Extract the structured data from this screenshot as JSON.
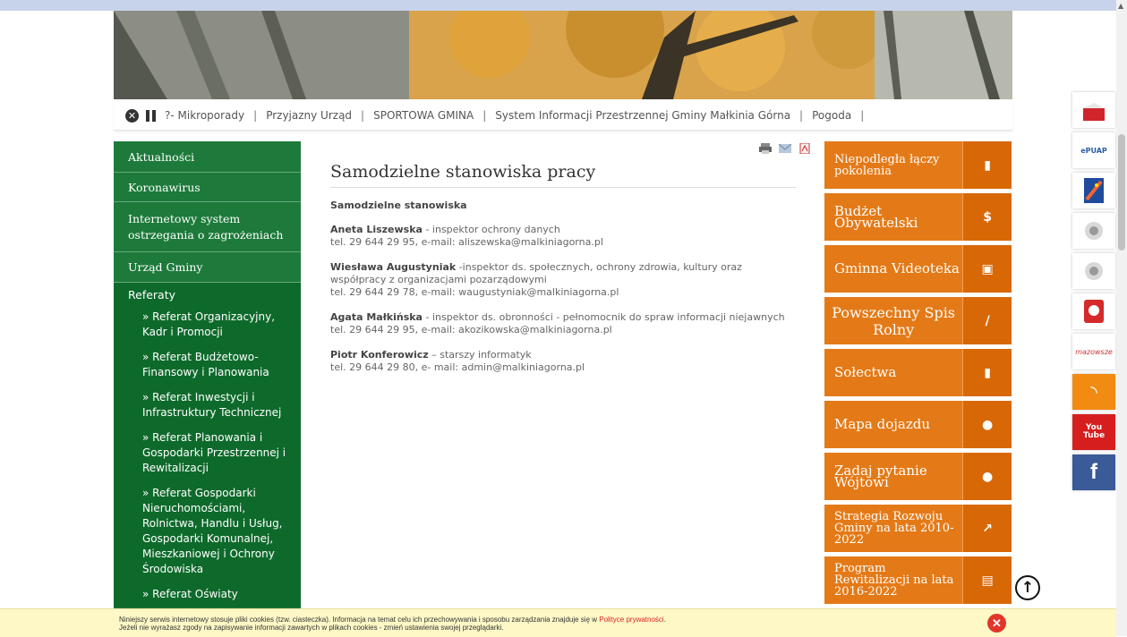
{
  "nav": {
    "items": [
      "?- Mikroporady",
      "Przyjazny Urząd",
      "SPORTOWA GMINA",
      "System Informacji Przestrzennej Gminy Małkinia Górna",
      "Pogoda"
    ],
    "sep": "|"
  },
  "sidebar": {
    "items": [
      "Aktualności",
      "Koronawirus",
      "Internetowy system ostrzegania o zagrożeniach",
      "Urząd Gminy"
    ],
    "sub_head": "Referaty",
    "sub_links": [
      "» Referat Organizacyjny, Kadr i Promocji",
      "» Referat Budżetowo-Finansowy i Planowania",
      "» Referat Inwestycji i Infrastruktury Technicznej",
      "» Referat Planowania i Gospodarki Przestrzennej i Rewitalizacji",
      "» Referat Gospodarki Nieruchomościami, Rolnictwa, Handlu i Usług, Gospodarki Komunalnej, Mieszkaniowej i Ochrony Środowiska",
      "» Referat Oświaty"
    ]
  },
  "main": {
    "title": "Samodzielne stanowiska pracy",
    "section": "Samodzielne stanowiska",
    "people": [
      {
        "name": "Aneta Liszewska",
        "role": " - inspektor ochrony danych",
        "contact": "tel. 29 644 29 95, e-mail: aliszewska@malkiniagorna.pl"
      },
      {
        "name": "Wiesława Augustyniak",
        "role": " -inspektor ds. społecznych, ochrony zdrowia, kultury oraz współpracy z organizacjami pozarządowymi",
        "contact": "tel. 29 644 29 78, e-mail: waugustyniak@malkiniagorna.pl"
      },
      {
        "name": "Agata Małkińska",
        "role": " - inspektor ds. obronności  - pełnomocnik do spraw informacji niejawnych",
        "contact": "tel. 29 644 29 95, e-mail: akozikowska@malkiniagorna.pl"
      },
      {
        "name": "Piotr Konferowicz",
        "role": " – starszy informatyk",
        "contact": "tel. 29 644 29 80, e- mail: admin@malkiniagorna.pl"
      }
    ]
  },
  "tiles": [
    {
      "label": "Niepodległa łączy pokolenia",
      "icon": "map-icon",
      "glyph": "▮"
    },
    {
      "label": "Budżet Obywatelski",
      "icon": "dollar-icon",
      "glyph": "$"
    },
    {
      "label": "Gminna Videoteka",
      "icon": "film-icon",
      "glyph": "▣"
    },
    {
      "label": "Powszechny Spis Rolny",
      "icon": "pencil-icon",
      "glyph": "/"
    },
    {
      "label": "Sołectwa",
      "icon": "map-icon",
      "glyph": "▮"
    },
    {
      "label": "Mapa dojazdu",
      "icon": "pin-icon",
      "glyph": "●"
    },
    {
      "label": "Zadaj pytanie Wójtowi",
      "icon": "chat-icon",
      "glyph": "●"
    },
    {
      "label": "Strategia Rozwoju Gminy na lata 2010-2022",
      "icon": "chart-icon",
      "glyph": "↗"
    },
    {
      "label": "Program Rewitalizacji na lata 2016-2022",
      "icon": "documents-icon",
      "glyph": "▤"
    }
  ],
  "social": {
    "bip": "bip",
    "epuap": "ePUAP",
    "rss": "◝",
    "youtube_1": "You",
    "youtube_2": "Tube",
    "facebook": "f",
    "mazowsze": "mazowsze"
  },
  "cookie": {
    "line1_a": "Niniejszy serwis internetowy stosuje pliki cookies (tzw. ciasteczka). Informacja na temat celu ich przechowywania i sposobu zarządzania znajduje się w ",
    "line1_link": "Polityce prywatności",
    "line1_b": ".",
    "line2": "Jeżeli nie wyrażasz zgody na zapisywanie informacji zawartych w plikach cookies - zmień ustawienia swojej przeglądarki.",
    "close": "✕"
  },
  "colors": {
    "green": "#1d7a3a",
    "orange": "#e47a17",
    "cookie_bg": "#fdf8c6"
  }
}
